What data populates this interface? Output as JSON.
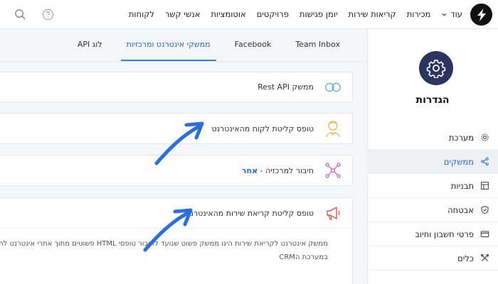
{
  "nav": {
    "items": [
      "לקוחות",
      "אנשי קשר",
      "אוטומציות",
      "פרויקטים",
      "יומן פגישות",
      "קריאות שירות",
      "מכירות"
    ],
    "more_label": "עוד"
  },
  "sidebar": {
    "title": "הגדרות",
    "items": [
      {
        "label": "מערכת",
        "icon": "gear-icon",
        "active": false
      },
      {
        "label": "ממשקים",
        "icon": "share-icon",
        "active": true
      },
      {
        "label": "תבניות",
        "icon": "layout-icon",
        "active": false
      },
      {
        "label": "אבטחה",
        "icon": "shield-icon",
        "active": false
      },
      {
        "label": "פרטי חשבון וחיוב",
        "icon": "credit-card-icon",
        "active": false
      },
      {
        "label": "כלים",
        "icon": "tools-icon",
        "active": false
      }
    ]
  },
  "tabs": [
    {
      "label": "Team Inbox",
      "active": false
    },
    {
      "label": "Facebook",
      "active": false
    },
    {
      "label": "ממשקי אינטרנט ומרכזיות",
      "active": true
    },
    {
      "label": "לוג API",
      "active": false
    }
  ],
  "cards": {
    "rest_api": {
      "label": "ממשק Rest API"
    },
    "lead_form": {
      "label": "טופס קליטת לקוח מהאינטרנט"
    },
    "pbx": {
      "label": "חיבור למרכזיה - ",
      "link": "אחר"
    },
    "service_form": {
      "label": "טופס קליטת קריאת שירות מהאינטרנט",
      "desc_line1": "ממשק אינטרנט לקריאת שירות הינו ממשק פשוט שנועד לחיבור טופסי HTML פשוטים מתוך אתרי אינטרנט לתוך",
      "desc_line2": "במערכת הCRM"
    }
  },
  "colors": {
    "accent": "#2867d6",
    "arrow": "#2a6ee0",
    "badge": "#2c3462"
  }
}
